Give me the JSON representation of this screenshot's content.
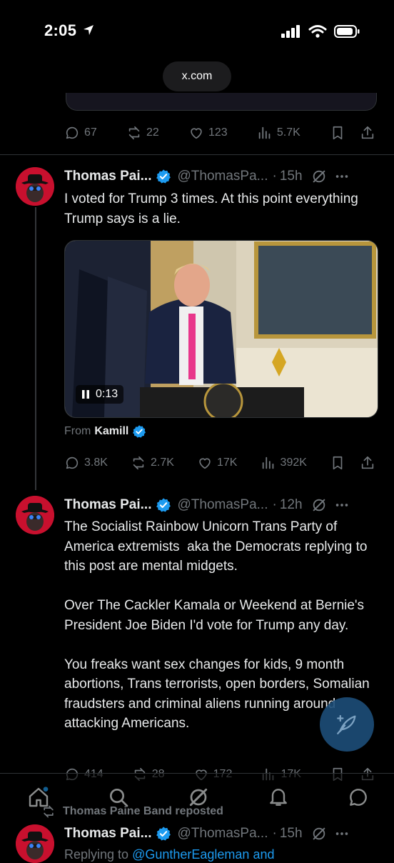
{
  "status": {
    "time": "2:05"
  },
  "browser": {
    "url": "x.com"
  },
  "prev_tweet": {
    "replies": "67",
    "reposts": "22",
    "likes": "123",
    "views": "5.7K"
  },
  "tweets": [
    {
      "name": "Thomas Pai...",
      "handle": "@ThomasPa...",
      "time": "15h",
      "text": "I voted for Trump 3 times. At this point everything Trump says is a lie.",
      "video_time": "0:13",
      "from_label": "From",
      "from_name": "Kamill",
      "replies": "3.8K",
      "reposts": "2.7K",
      "likes": "17K",
      "views": "392K"
    },
    {
      "name": "Thomas Pai...",
      "handle": "@ThomasPa...",
      "time": "12h",
      "text": "The Socialist Rainbow Unicorn Trans Party of America extremists  aka the Democrats replying to this post are mental midgets.\n\nOver The Cackler Kamala or Weekend at Bernie's President Joe Biden I'd vote for Trump any day.\n\nYou freaks want sex changes for kids, 9 month abortions, Trans terrorists, open borders, Somalian fraudsters and criminal aliens running around attacking Americans.",
      "replies": "414",
      "reposts": "28",
      "likes": "172",
      "views": "17K"
    },
    {
      "repost_label": "Thomas Paine Band reposted",
      "name": "Thomas Pai...",
      "handle": "@ThomasPa...",
      "time": "15h",
      "replying_prefix": "Replying to",
      "replying_to": "@GuntherEagleman and"
    }
  ],
  "colors": {
    "accent": "#1d9bf0",
    "muted": "#71767b",
    "background": "#000000",
    "avatar": "#c8102e"
  }
}
